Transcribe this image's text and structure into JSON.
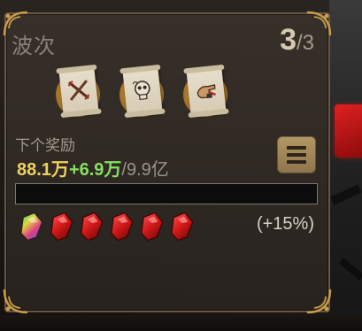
{
  "wave": {
    "label": "波次",
    "current": "3",
    "total": "/3"
  },
  "rewards": [
    {
      "icon": "crossed-swords-scroll-icon"
    },
    {
      "icon": "skull-scroll-icon"
    },
    {
      "icon": "hand-scroll-icon"
    }
  ],
  "next_reward": {
    "label": "下个奖励",
    "current": "88.1万",
    "increment": "+6.9万",
    "target": "/9.9亿",
    "progress": 0
  },
  "menu_button": {
    "icon": "list-menu-icon"
  },
  "gems": [
    {
      "type": "rainbow",
      "icon": "rainbow-gem-icon"
    },
    {
      "type": "red",
      "icon": "red-gem-icon"
    },
    {
      "type": "red",
      "icon": "red-gem-icon"
    },
    {
      "type": "red",
      "icon": "red-gem-icon"
    },
    {
      "type": "red",
      "icon": "red-gem-icon"
    },
    {
      "type": "red",
      "icon": "red-gem-icon"
    }
  ],
  "bonus": "(+15%)",
  "colors": {
    "accent_gold": "#c89a4a",
    "reward_current": "#f0d260",
    "reward_increment": "#86e060",
    "reward_target": "#9a948c"
  }
}
